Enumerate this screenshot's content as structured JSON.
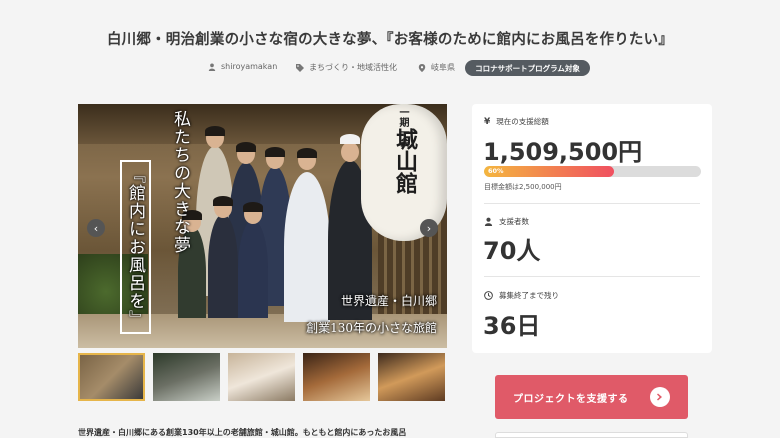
{
  "project": {
    "title": "白川郷・明治創業の小さな宿の大きな夢、『お客様のために館内にお風呂を作りたい』",
    "owner": "shiroyamakan",
    "category": "まちづくり・地域活性化",
    "location": "岐阜県",
    "badge": "コロナサポートプログラム対象"
  },
  "hero": {
    "vertical_text_1": "私たちの大きな夢",
    "vertical_text_2": "『館内にお風呂を』",
    "lantern_text": "城山館",
    "lantern_top_text": "一期一会",
    "caption_1": "世界遺産・白川郷",
    "caption_2": "創業130年の小さな旅館",
    "prev_label": "‹",
    "next_label": "›"
  },
  "thumbnails": [
    {
      "name": "thumb-1"
    },
    {
      "name": "thumb-2"
    },
    {
      "name": "thumb-3"
    },
    {
      "name": "thumb-4"
    },
    {
      "name": "thumb-5"
    }
  ],
  "stats": {
    "amount_label": "現在の支援総額",
    "amount": "1,509,500円",
    "progress": 0.6,
    "progress_text": "60%",
    "goal": "目標金額は2,500,000円",
    "supporters_label": "支援者数",
    "supporters": "70人",
    "remaining_label": "募集終了まで残り",
    "remaining": "36日"
  },
  "support_button": "プロジェクトを支援する",
  "description": "世界遺産・白川郷にある創業130年以上の老舗旅館・城山館。もともと館内にあったお風呂",
  "colors": {
    "badge": "#555b61",
    "accent": "#e05a68",
    "progress_start": "#f4b63f",
    "progress_end": "#f05060"
  }
}
